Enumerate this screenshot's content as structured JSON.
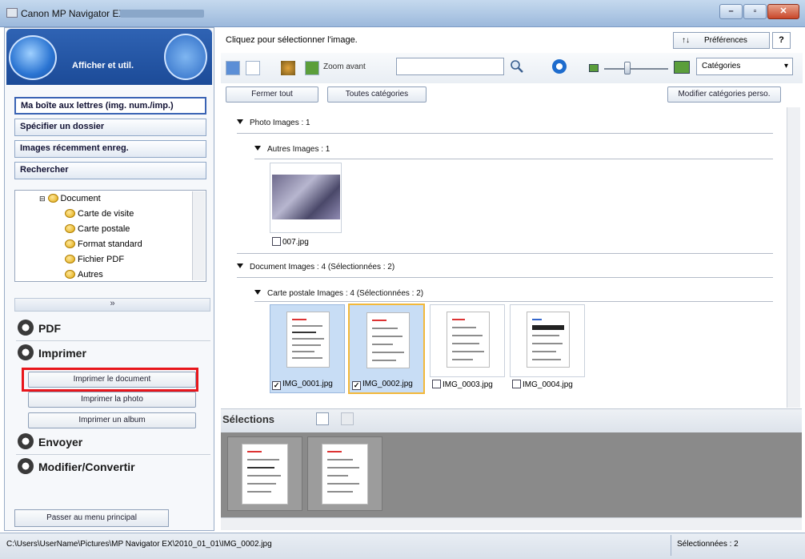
{
  "window": {
    "title": "Canon MP Navigator EX -"
  },
  "left": {
    "banner_label": "Afficher et util.",
    "nav": [
      "Ma boîte aux lettres (img. num./imp.)",
      "Spécifier un dossier",
      "Images récemment enreg.",
      "Rechercher"
    ],
    "tree": [
      "Document",
      "Carte de visite",
      "Carte postale",
      "Format standard",
      "Fichier PDF",
      "Autres"
    ],
    "collapse": "»",
    "categories": {
      "pdf": "PDF",
      "print": "Imprimer",
      "send": "Envoyer",
      "edit": "Modifier/Convertir"
    },
    "print_items": [
      "Imprimer le document",
      "Imprimer la photo",
      "Imprimer un album"
    ],
    "main_menu": "Passer au menu principal"
  },
  "right": {
    "instruction": "Cliquez pour sélectionner l'image.",
    "preferences": "Préférences",
    "help": "?",
    "zoom_label": "Zoom avant",
    "search_value": "",
    "category_select": "Catégories",
    "close_all": "Fermer tout",
    "all_categories": "Toutes catégories",
    "edit_categories": "Modifier catégories perso.",
    "groups": {
      "photo": "Photo   Images : 1",
      "autres": "Autres   Images : 1",
      "document": "Document   Images : 4   (Sélectionnées : 2)",
      "carte": "Carte postale   Images : 4   (Sélectionnées : 2)"
    },
    "files": {
      "photo": "007.jpg",
      "doc": [
        "IMG_0001.jpg",
        "IMG_0002.jpg",
        "IMG_0003.jpg",
        "IMG_0004.jpg"
      ]
    },
    "selections_title": "Sélections"
  },
  "status": {
    "path": "C:\\Users\\UserName\\Pictures\\MP Navigator EX\\2010_01_01\\IMG_0002.jpg",
    "selected": "Sélectionnées : 2"
  },
  "colors": {
    "accent": "#2f63b4",
    "highlight": "#e8161b",
    "focus": "#f2b83a"
  }
}
